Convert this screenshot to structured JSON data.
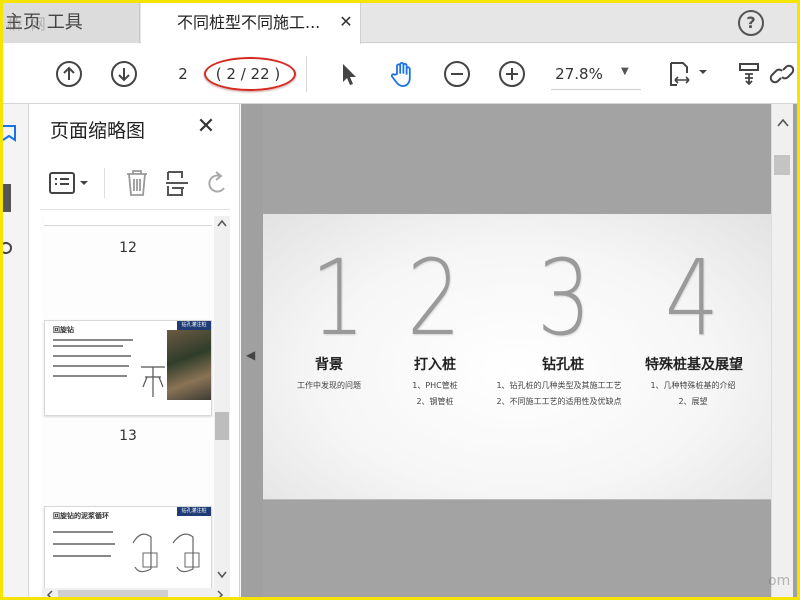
{
  "tabs": {
    "home_label": "主页 工具",
    "doc_label": "不同桩型不同施工...",
    "close_glyph": "✕",
    "help_glyph": "?"
  },
  "watermark": {
    "top": "桥 网",
    "bottom": "om"
  },
  "toolbar": {
    "page_value": "2",
    "page_count": "( 2 / 22 )",
    "zoom_value": "27.8%",
    "zoom_caret": "▼",
    "highlight_color": "#d42a20"
  },
  "thumbnail_panel": {
    "title": "页面缩略图",
    "close_glyph": "✕",
    "thumbnails": [
      {
        "page": "12"
      },
      {
        "page": "13",
        "title": "回旋钻",
        "tag": "钻孔灌注桩"
      },
      {
        "title": "回旋钻的泥浆循环",
        "tag": "钻孔灌注桩"
      }
    ]
  },
  "slide": {
    "sections": [
      {
        "number": "1",
        "title": "背景",
        "items": [
          "工作中发现的问题"
        ]
      },
      {
        "number": "2",
        "title": "打入桩",
        "items": [
          "1、PHC管桩",
          "2、钢管桩"
        ]
      },
      {
        "number": "3",
        "title": "钻孔桩",
        "items": [
          "1、钻孔桩的几种类型及其施工工艺",
          "2、不同施工工艺的适用性及优缺点"
        ]
      },
      {
        "number": "4",
        "title": "特殊桩基及展望",
        "items": [
          "1、几种特殊桩基的介绍",
          "2、展望"
        ]
      }
    ]
  },
  "colors": {
    "border": "#f5e400",
    "accent_blue": "#1a73e8",
    "thumb_tag": "#1f3d74"
  }
}
